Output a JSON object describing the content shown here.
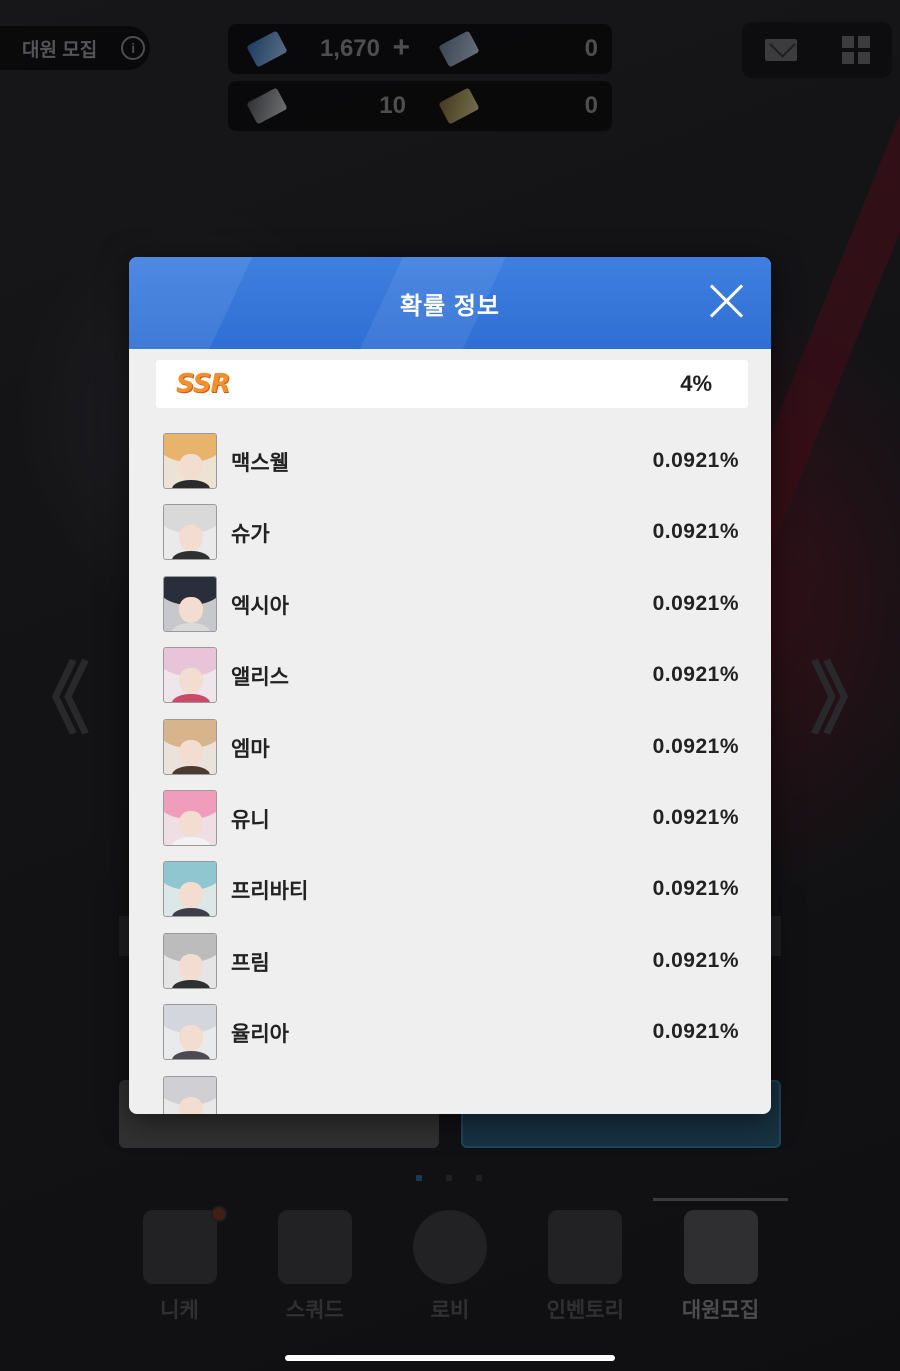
{
  "topbar": {
    "title": "대원 모집",
    "info_icon": "info-icon",
    "currencies": [
      {
        "icon": "gem-icon",
        "value": "1,670",
        "has_plus": true
      },
      {
        "icon": "ticket-icon",
        "value": "0"
      },
      {
        "icon": "wing-ticket-icon",
        "value": "10"
      },
      {
        "icon": "gold-ticket-icon",
        "value": "0"
      }
    ],
    "right_icons": [
      "mail-icon",
      "menu-grid-icon"
    ]
  },
  "nav_arrows": {
    "left": "《",
    "right": "》"
  },
  "modal": {
    "title": "확률 정보",
    "close_icon": "close-icon",
    "rank": {
      "label": "SSR",
      "rate": "4%",
      "color": "#f2902a"
    },
    "items": [
      {
        "name": "맥스웰",
        "rate": "0.0921%",
        "hair": "#e8b36a",
        "body": "#2b2b2b"
      },
      {
        "name": "슈가",
        "rate": "0.0921%",
        "hair": "#d9d9d9",
        "body": "#303030"
      },
      {
        "name": "엑시아",
        "rate": "0.0921%",
        "hair": "#2a2d3a",
        "body": "#dadada"
      },
      {
        "name": "앨리스",
        "rate": "0.0921%",
        "hair": "#e9c3d8",
        "body": "#c94a6a"
      },
      {
        "name": "엠마",
        "rate": "0.0921%",
        "hair": "#d7b48c",
        "body": "#4a3a33"
      },
      {
        "name": "유니",
        "rate": "0.0921%",
        "hair": "#ef9dbb",
        "body": "#f2f2f2"
      },
      {
        "name": "프리바티",
        "rate": "0.0921%",
        "hair": "#8fc6cf",
        "body": "#3a3f48"
      },
      {
        "name": "프림",
        "rate": "0.0921%",
        "hair": "#bcbcbc",
        "body": "#2f2f2f"
      },
      {
        "name": "율리아",
        "rate": "0.0921%",
        "hair": "#d3d6dc",
        "body": "#4a4a52"
      }
    ]
  },
  "tabbar": {
    "tabs": [
      {
        "label": "니케",
        "icon": "nikke-icon",
        "badge": true
      },
      {
        "label": "스쿼드",
        "icon": "squad-icon"
      },
      {
        "label": "로비",
        "icon": "lobby-icon"
      },
      {
        "label": "인벤토리",
        "icon": "inventory-icon"
      },
      {
        "label": "대원모집",
        "icon": "recruit-icon",
        "active": true
      }
    ]
  }
}
